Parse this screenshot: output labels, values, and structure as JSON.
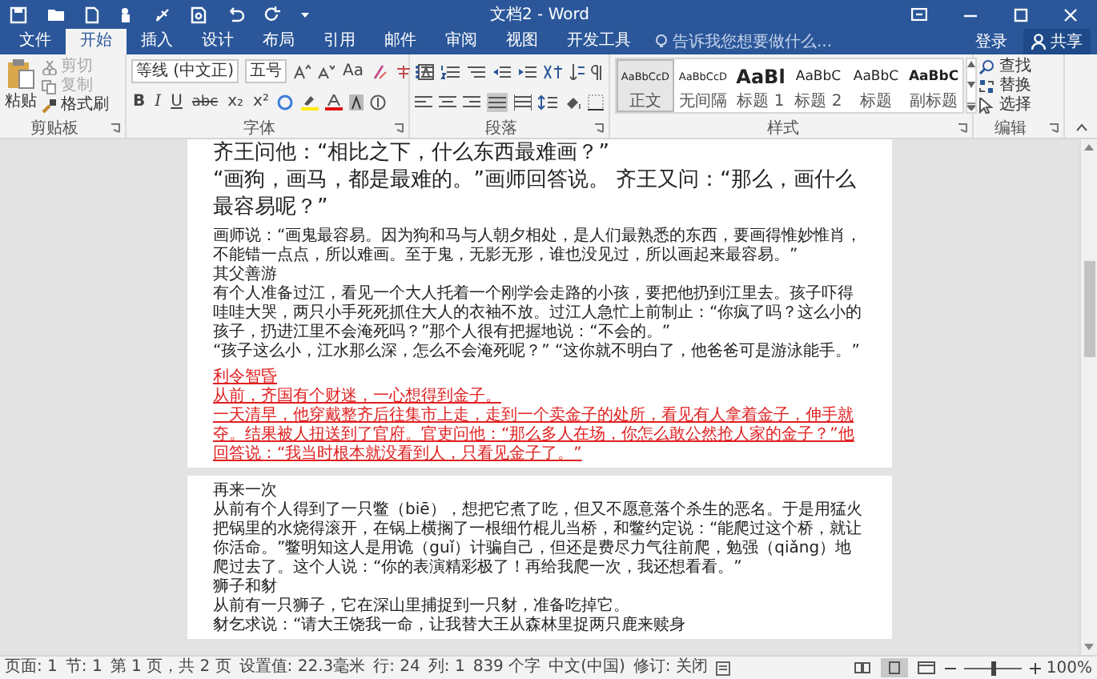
{
  "window": {
    "title": "文档2 - Word"
  },
  "tabs": [
    {
      "label": "文件",
      "selected": false
    },
    {
      "label": "开始",
      "selected": true
    },
    {
      "label": "插入",
      "selected": false
    },
    {
      "label": "设计",
      "selected": false
    },
    {
      "label": "布局",
      "selected": false
    },
    {
      "label": "引用",
      "selected": false
    },
    {
      "label": "邮件",
      "selected": false
    },
    {
      "label": "审阅",
      "selected": false
    },
    {
      "label": "视图",
      "selected": false
    },
    {
      "label": "开发工具",
      "selected": false
    }
  ],
  "search": {
    "placeholder": "告诉我您想要做什么..."
  },
  "account": {
    "sign_in": "登录",
    "share": "共享"
  },
  "ribbon": {
    "clipboard": {
      "label": "剪贴板",
      "paste": "粘贴",
      "cut": "剪切",
      "copy": "复制",
      "format_painter": "格式刷"
    },
    "font": {
      "label": "字体",
      "font_name": "等线 (中文正)",
      "font_size": "五号",
      "change_case": "Aa",
      "styles": [
        "B",
        "I",
        "U",
        "abc",
        "x₂",
        "x²"
      ]
    },
    "paragraph": {
      "label": "段落"
    },
    "styles": {
      "label": "样式",
      "items": [
        {
          "preview": "AaBbCcD",
          "name": "正文",
          "kind": "normal",
          "selected": true
        },
        {
          "preview": "AaBbCcD",
          "name": "无间隔",
          "kind": "normal",
          "selected": false
        },
        {
          "preview": "AaBl",
          "name": "标题 1",
          "kind": "h1",
          "selected": false
        },
        {
          "preview": "AaBbC",
          "name": "标题 2",
          "kind": "h2",
          "selected": false
        },
        {
          "preview": "AaBbC",
          "name": "标题",
          "kind": "title",
          "selected": false
        },
        {
          "preview": "AaBbC",
          "name": "副标题",
          "kind": "subtitle",
          "selected": false
        }
      ]
    },
    "editing": {
      "label": "编辑",
      "find": "查找",
      "replace": "替换",
      "select": "选择"
    }
  },
  "pages": [
    {
      "paragraphs": [
        {
          "kind": "large",
          "text": "齐王问他：“相比之下，什么东西最难画？”"
        },
        {
          "kind": "large",
          "text": "“画狗，画马，都是最难的。”画师回答说。 齐王又问：“那么，画什么最容易呢？”"
        },
        {
          "kind": "body",
          "text": "画师说：“画鬼最容易。因为狗和马与人朝夕相处，是人们最熟悉的东西，要画得惟妙惟肖，不能错一点点，所以难画。至于鬼，无影无形，谁也没见过，所以画起来最容易。”"
        },
        {
          "kind": "body",
          "text": "其父善游"
        },
        {
          "kind": "body",
          "text": "有个人准备过江，看见一个大人托着一个刚学会走路的小孩，要把他扔到江里去。孩子吓得哇哇大哭，两只小手死死抓住大人的衣袖不放。过江人急忙上前制止：“你疯了吗？这么小的孩子，扔进江里不会淹死吗？”那个人很有把握地说：“不会的。”"
        },
        {
          "kind": "body",
          "text": "“孩子这么小，江水那么深，怎么不会淹死呢？” “这你就不明白了，他爸爸可是游泳能手。”"
        },
        {
          "kind": "revision",
          "text": "利令智昏"
        },
        {
          "kind": "revision",
          "text": "从前，齐国有个财迷，一心想得到金子。"
        },
        {
          "kind": "revision",
          "text": "一天清早，他穿戴整齐后往集市上走，走到一个卖金子的处所，看见有人拿着金子，伸手就夺。结果被人扭送到了官府。官吏问他：“那么多人在场，你怎么敢公然抢人家的金子？”他回答说：“我当时根本就没看到人，只看见金子了。”"
        }
      ]
    },
    {
      "paragraphs": [
        {
          "kind": "body",
          "text": " 再来一次"
        },
        {
          "kind": "body",
          "text": "从前有个人得到了一只鳖（biē），想把它煮了吃，但又不愿意落个杀生的恶名。于是用猛火把锅里的水烧得滚开，在锅上横搁了一根细竹棍儿当桥，和鳖约定说：“能爬过这个桥，就让你活命。”鳖明知这人是用诡（guǐ）计骗自己，但还是费尽力气往前爬，勉强（qiǎng）地爬过去了。这个人说：“你的表演精彩极了！再给我爬一次，我还想看看。”"
        },
        {
          "kind": "body",
          "text": "狮子和豺"
        },
        {
          "kind": "body",
          "text": "从前有一只狮子，它在深山里捕捉到一只豺，准备吃掉它。"
        },
        {
          "kind": "body",
          "text": "豺乞求说：“请大王饶我一命，让我替大王从森林里捉两只鹿来赎身"
        }
      ]
    }
  ],
  "status_bar": {
    "items": [
      "页面: 1",
      "节: 1",
      "第 1 页，共 2 页",
      "设置值: 22.3毫米",
      "行: 24",
      "列: 1",
      "839 个字",
      "中文(中国)",
      "修订: 关闭"
    ],
    "views": [
      {
        "selected": false
      },
      {
        "selected": true
      },
      {
        "selected": false
      }
    ],
    "zoom": {
      "level": 0.5,
      "percent": "100%"
    }
  }
}
